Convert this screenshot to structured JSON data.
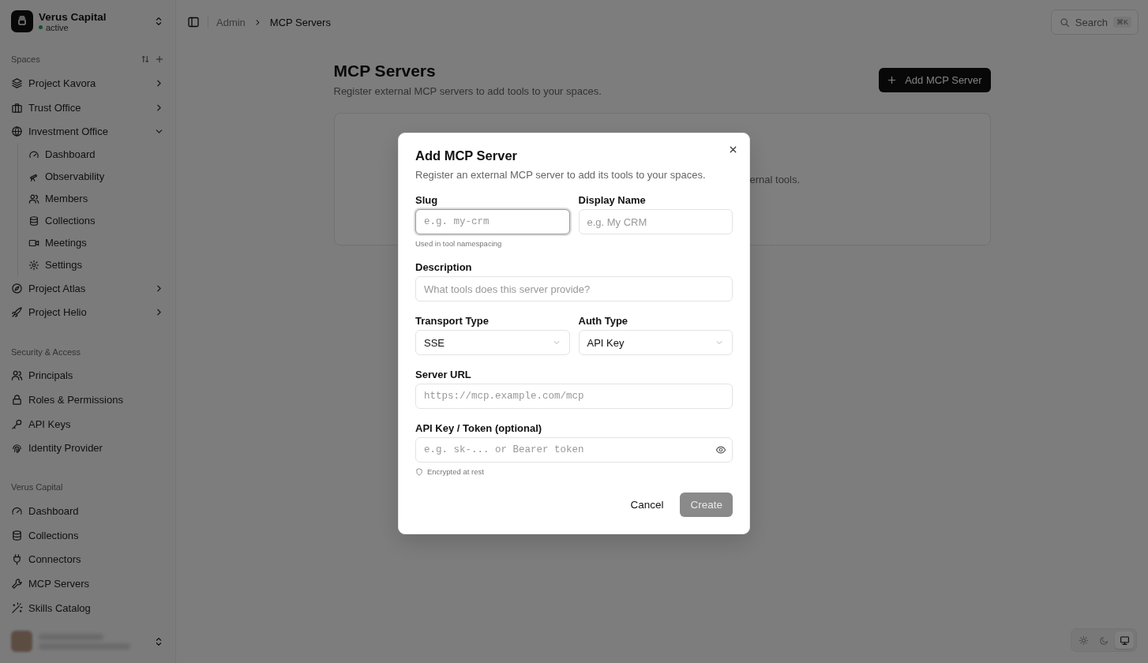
{
  "sidebar": {
    "org": {
      "name": "Verus Capital",
      "status": "active"
    },
    "sections": [
      {
        "title": "Spaces",
        "items": [
          {
            "label": "Project Kavora",
            "expanded": false
          },
          {
            "label": "Trust Office",
            "expanded": false
          },
          {
            "label": "Investment Office",
            "expanded": true,
            "children": [
              {
                "label": "Dashboard"
              },
              {
                "label": "Observability"
              },
              {
                "label": "Members"
              },
              {
                "label": "Collections"
              },
              {
                "label": "Meetings"
              },
              {
                "label": "Settings"
              }
            ]
          },
          {
            "label": "Project Atlas",
            "expanded": false
          },
          {
            "label": "Project Helio",
            "expanded": false
          }
        ]
      },
      {
        "title": "Security & Access",
        "items": [
          {
            "label": "Principals"
          },
          {
            "label": "Roles & Permissions"
          },
          {
            "label": "API Keys"
          },
          {
            "label": "Identity Provider"
          }
        ]
      },
      {
        "title": "Verus Capital",
        "items": [
          {
            "label": "Dashboard"
          },
          {
            "label": "Collections"
          },
          {
            "label": "Connectors"
          },
          {
            "label": "MCP Servers"
          },
          {
            "label": "Skills Catalog"
          }
        ]
      }
    ]
  },
  "header": {
    "breadcrumb": [
      "Admin",
      "MCP Servers"
    ],
    "search": {
      "label": "Search",
      "shortcut": "⌘K"
    }
  },
  "page": {
    "title": "MCP Servers",
    "subtitle": "Register external MCP servers to add tools to your spaces.",
    "add_button": "Add MCP Server",
    "empty_state_text": "ernal tools."
  },
  "dialog": {
    "title": "Add MCP Server",
    "description": "Register an external MCP server to add its tools to your spaces.",
    "rows": [
      [
        {
          "kind": "input",
          "label": "Slug",
          "placeholder": "e.g. my-crm",
          "mono": true,
          "focused": true,
          "hint": "Used in tool namespacing"
        },
        {
          "kind": "input",
          "label": "Display Name",
          "placeholder": "e.g. My CRM",
          "mono": false,
          "focused": false
        }
      ],
      [
        {
          "kind": "input",
          "label": "Description",
          "placeholder": "What tools does this server provide?",
          "mono": false,
          "focused": false
        }
      ],
      [
        {
          "kind": "select",
          "label": "Transport Type",
          "value": "SSE"
        },
        {
          "kind": "select",
          "label": "Auth Type",
          "value": "API Key"
        }
      ],
      [
        {
          "kind": "input",
          "label": "Server URL",
          "placeholder": "https://mcp.example.com/mcp",
          "mono": true,
          "focused": false
        }
      ],
      [
        {
          "kind": "secret",
          "label": "API Key / Token (optional)",
          "placeholder": "e.g. sk-... or Bearer token",
          "mono": true,
          "focused": false,
          "hint": "Encrypted at rest"
        }
      ]
    ],
    "cancel": "Cancel",
    "create": {
      "label": "Create",
      "disabled": true
    }
  },
  "theme_options": [
    {
      "selected": false
    },
    {
      "selected": false
    },
    {
      "selected": true
    }
  ]
}
